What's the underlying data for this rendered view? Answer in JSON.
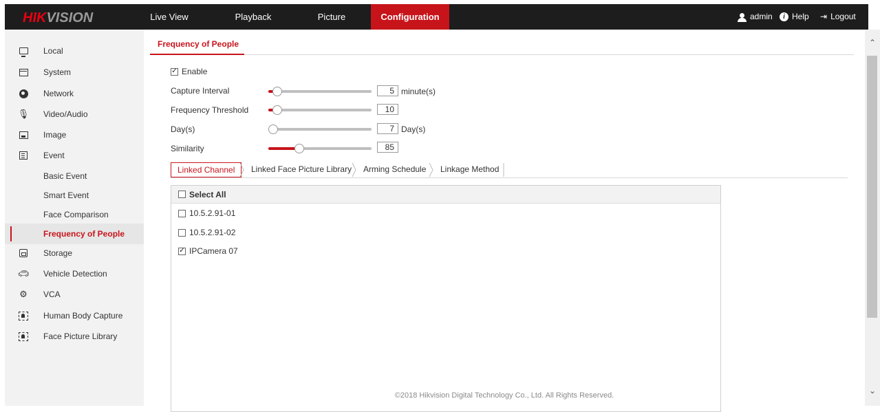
{
  "brand": {
    "logo_red": "HIK",
    "logo_gray": "VISION"
  },
  "nav": {
    "items": [
      "Live View",
      "Playback",
      "Picture",
      "Configuration"
    ],
    "active": "Configuration"
  },
  "topright": {
    "user": "admin",
    "help": "Help",
    "logout": "Logout"
  },
  "sidebar": {
    "items": [
      {
        "label": "Local",
        "icon": "monitor-icon"
      },
      {
        "label": "System",
        "icon": "system-icon"
      },
      {
        "label": "Network",
        "icon": "network-icon"
      },
      {
        "label": "Video/Audio",
        "icon": "microphone-icon"
      },
      {
        "label": "Image",
        "icon": "image-icon"
      },
      {
        "label": "Event",
        "icon": "event-icon"
      },
      {
        "label": "Basic Event"
      },
      {
        "label": "Smart Event"
      },
      {
        "label": "Face Comparison"
      },
      {
        "label": "Frequency of People"
      },
      {
        "label": "Storage",
        "icon": "storage-icon"
      },
      {
        "label": "Vehicle Detection",
        "icon": "vehicle-icon"
      },
      {
        "label": "VCA",
        "icon": "vca-icon"
      },
      {
        "label": "Human Body Capture",
        "icon": "human-body-icon"
      },
      {
        "label": "Face Picture Library",
        "icon": "face-library-icon"
      }
    ],
    "active": "Frequency of People"
  },
  "page": {
    "tab": "Frequency of People",
    "enable_label": "Enable",
    "enable_checked": true,
    "settings": [
      {
        "label": "Capture Interval",
        "value": "5",
        "unit": "minute(s)",
        "fraction": 0.06
      },
      {
        "label": "Frequency Threshold",
        "value": "10",
        "unit": "",
        "fraction": 0.06
      },
      {
        "label": "Day(s)",
        "value": "7",
        "unit": "Day(s)",
        "fraction": 0.0
      },
      {
        "label": "Similarity",
        "value": "85",
        "unit": "",
        "fraction": 0.27
      }
    ],
    "subtabs": [
      "Linked Channel",
      "Linked Face Picture Library",
      "Arming Schedule",
      "Linkage Method"
    ],
    "active_subtab": "Linked Channel",
    "select_all": "Select All",
    "channels": [
      {
        "name": "10.5.2.91-01",
        "checked": false
      },
      {
        "name": "10.5.2.91-02",
        "checked": false
      },
      {
        "name": "IPCamera 07",
        "checked": true
      }
    ]
  },
  "footer": "©2018 Hikvision Digital Technology Co., Ltd. All Rights Reserved.",
  "colors": {
    "accent": "#c7141a",
    "topbar": "#1d1d1d",
    "sidebar": "#f2f2f2"
  }
}
